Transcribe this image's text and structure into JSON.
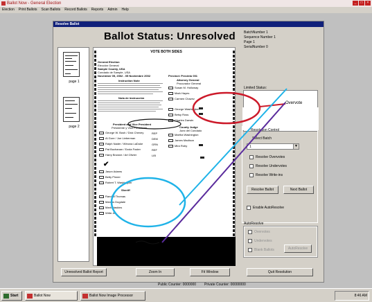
{
  "window": {
    "title": "Ballot Now - General Election"
  },
  "menu": [
    "Election",
    "Print Ballots",
    "Scan Ballots",
    "Record Ballots",
    "Reports",
    "Admin",
    "Help"
  ],
  "dialog": {
    "title": "Resolve Ballot"
  },
  "status": {
    "heading": "Ballot Status:  Unresolved"
  },
  "info": {
    "batch": "BatchNumber 1",
    "sequence": "Sequence Number 1",
    "page": "Page 1",
    "serial": "SerialNumber 0",
    "limited_label": "Limited Status:"
  },
  "thumbnails": [
    {
      "label": "page 1"
    },
    {
      "label": "page 2"
    }
  ],
  "ballot": {
    "header": "VOTE BOTH SIDES",
    "election": "General Election",
    "election_es": "Elección General",
    "county": "Sample County, USA",
    "county_es": "Condado de Sample, USA",
    "date": "November 05, 2002 - 05 Noviembre 2002",
    "precinct": "Precinct: Precinto 001",
    "instr": "Instruction Note",
    "instr_es": "Nota de instrucción",
    "pres": "President and Vice President",
    "pres_es": "Presidente y Vice Presidente",
    "pres_cands": [
      "George W. Bush / Dick Cheney",
      "Al Gore / Joe Lieberman",
      "Ralph Nader / Winona LaDuke",
      "Pat Buchanan / Ezola Foster",
      "Harry Browne / Art Olivier"
    ],
    "pres_party": [
      "REP",
      "DEM",
      "GRN",
      "REF",
      "LIB"
    ],
    "other_cands": [
      "Jason Adams",
      "Betty Pinner",
      "Robert T. Washington"
    ],
    "sheriff": "Sheriff",
    "sheriff_cands": [
      "Randall Thomas",
      "Marcus Dugdale",
      "Mark Haskins"
    ],
    "write_in": "Write-In",
    "atty": "Attorney General",
    "atty_es": "Procurador General",
    "atty_cands": [
      "Susan M. Holloway",
      "Mark Hayes",
      "Carmen Chavez"
    ],
    "mid_cands": [
      "George Washington",
      "Betsy Ross",
      "Charles Darwin"
    ],
    "county_judge": "County Judge",
    "county_judge_es": "Juez del Condado",
    "judge_cands": [
      "Martha Washington",
      "James Madison",
      "Mira Roby"
    ]
  },
  "annotation": {
    "overvote": "Overvote"
  },
  "resolution": {
    "group_title": "Resolution Control",
    "select_batch": "Select Batch",
    "batch_value": "1",
    "overvotes": "Resolve Overvotes",
    "undervotes": "Resolve Undervotes",
    "writeins": "Resolve Write-ins",
    "resolve_btn": "Resolve Ballot",
    "next_btn": "Next Ballot",
    "auto_resolve": "Enable AutoResolve"
  },
  "autoresolve": {
    "title": "AutoResolve",
    "opt1": "Overvotes",
    "opt2": "Undervotes",
    "opt3": "Blank Ballots",
    "btn": "AutoResolve"
  },
  "buttons": {
    "unresolved_report": "Unresolved Ballot Report",
    "zoom": "Zoom In",
    "fit": "Fit Window",
    "quit": "Quit Resolution"
  },
  "footer": {
    "public": "Public Counter: 0000000",
    "private": "Private Counter: 00000000"
  },
  "taskbar": {
    "start": "Start",
    "app1": "Ballot Now",
    "app2": "Ballot Now Image Processor",
    "time": "8:46 AM"
  },
  "colors": {
    "red_circle": "#cc1a2a",
    "blue": "#1fb3e8",
    "purple": "#5a2b9c"
  }
}
